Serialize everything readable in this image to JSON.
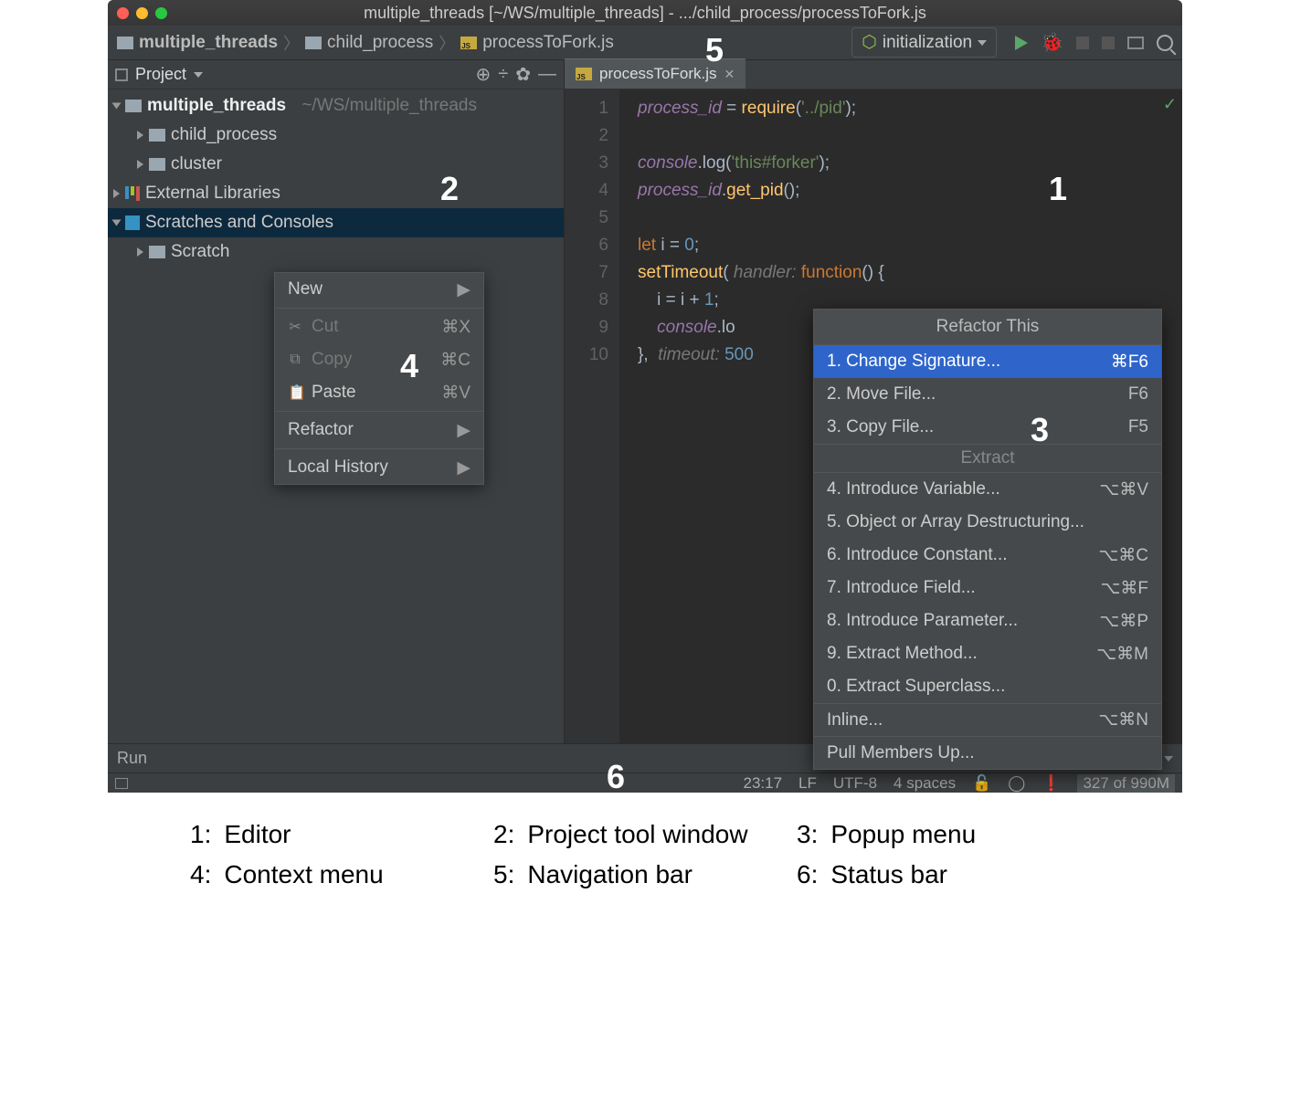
{
  "window": {
    "title": "multiple_threads [~/WS/multiple_threads] - .../child_process/processToFork.js"
  },
  "navbar": {
    "crumbs": [
      "multiple_threads",
      "child_process",
      "processToFork.js"
    ],
    "run_config": "initialization"
  },
  "sidebar": {
    "title": "Project",
    "root": {
      "name": "multiple_threads",
      "path": "~/WS/multiple_threads"
    },
    "children": [
      "child_process",
      "cluster"
    ],
    "external": "External Libraries",
    "scratches": "Scratches and Consoles",
    "scratch_child": "Scratch"
  },
  "tab": {
    "name": "processToFork.js"
  },
  "code": {
    "lines": [
      "1",
      "2",
      "3",
      "4",
      "5",
      "6",
      "7",
      "8",
      "9",
      "10"
    ],
    "l1a": "process_id",
    "l1b": " = ",
    "l1c": "require",
    "l1d": "(",
    "l1e": "'../pid'",
    "l1f": ");",
    "l3a": "console",
    "l3b": ".log(",
    "l3c": "'this#forker'",
    "l3d": ");",
    "l4a": "process_id",
    "l4b": ".",
    "l4c": "get_pid",
    "l4d": "();",
    "l6a": "let ",
    "l6b": "i = ",
    "l6c": "0",
    "l6d": ";",
    "l7a": "setTimeout",
    "l7b": "(",
    "l7h": " handler: ",
    "l7c": "function",
    "l7d": "() {",
    "l8a": "    i = i + ",
    "l8b": "1",
    "l8c": ";",
    "l9a": "    ",
    "l9b": "console",
    "l9c": ".lo",
    "l10a": "}",
    "l10b": ",",
    "l10t": "  timeout: ",
    "l10c": "500"
  },
  "context_menu": {
    "new": "New",
    "cut": "Cut",
    "cut_sc": "⌘X",
    "copy": "Copy",
    "copy_sc": "⌘C",
    "paste": "Paste",
    "paste_sc": "⌘V",
    "refactor": "Refactor",
    "history": "Local History"
  },
  "popup": {
    "title": "Refactor This",
    "i1": "1. Change Signature...",
    "i1s": "⌘F6",
    "i2": "2. Move File...",
    "i2s": "F6",
    "i3": "3. Copy File...",
    "i3s": "F5",
    "extract": "Extract",
    "i4": "4. Introduce Variable...",
    "i4s": "⌥⌘V",
    "i5": "5. Object or Array Destructuring...",
    "i6": "6. Introduce Constant...",
    "i6s": "⌥⌘C",
    "i7": "7. Introduce Field...",
    "i7s": "⌥⌘F",
    "i8": "8. Introduce Parameter...",
    "i8s": "⌥⌘P",
    "i9": "9. Extract Method...",
    "i9s": "⌥⌘M",
    "i0": "0. Extract Superclass...",
    "inline": "Inline...",
    "inline_s": "⌥⌘N",
    "pull": "Pull Members Up..."
  },
  "run": {
    "label": "Run"
  },
  "status": {
    "pos": "23:17",
    "sep": "LF",
    "enc": "UTF-8",
    "indent": "4 spaces",
    "mem_used": "327",
    "mem_of": " of 990M"
  },
  "overlays": {
    "n1": "1",
    "n2": "2",
    "n3": "3",
    "n4": "4",
    "n5": "5",
    "n6": "6"
  },
  "legend": {
    "l1": "Editor",
    "l2": "Project tool window",
    "l3": "Popup menu",
    "l4": "Context menu",
    "l5": "Navigation bar",
    "l6": "Status bar"
  }
}
